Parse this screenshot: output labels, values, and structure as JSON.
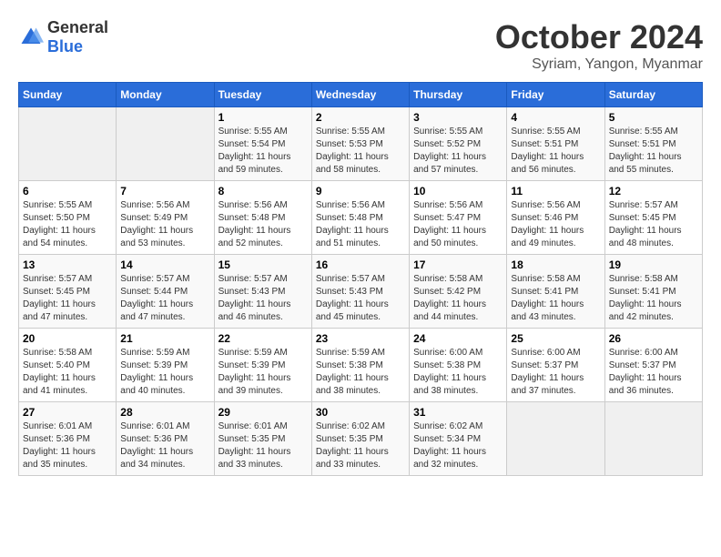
{
  "header": {
    "logo_general": "General",
    "logo_blue": "Blue",
    "title": "October 2024",
    "subtitle": "Syriam, Yangon, Myanmar"
  },
  "weekdays": [
    "Sunday",
    "Monday",
    "Tuesday",
    "Wednesday",
    "Thursday",
    "Friday",
    "Saturday"
  ],
  "weeks": [
    [
      {
        "day": "",
        "sunrise": "",
        "sunset": "",
        "daylight": ""
      },
      {
        "day": "",
        "sunrise": "",
        "sunset": "",
        "daylight": ""
      },
      {
        "day": "1",
        "sunrise": "Sunrise: 5:55 AM",
        "sunset": "Sunset: 5:54 PM",
        "daylight": "Daylight: 11 hours and 59 minutes."
      },
      {
        "day": "2",
        "sunrise": "Sunrise: 5:55 AM",
        "sunset": "Sunset: 5:53 PM",
        "daylight": "Daylight: 11 hours and 58 minutes."
      },
      {
        "day": "3",
        "sunrise": "Sunrise: 5:55 AM",
        "sunset": "Sunset: 5:52 PM",
        "daylight": "Daylight: 11 hours and 57 minutes."
      },
      {
        "day": "4",
        "sunrise": "Sunrise: 5:55 AM",
        "sunset": "Sunset: 5:51 PM",
        "daylight": "Daylight: 11 hours and 56 minutes."
      },
      {
        "day": "5",
        "sunrise": "Sunrise: 5:55 AM",
        "sunset": "Sunset: 5:51 PM",
        "daylight": "Daylight: 11 hours and 55 minutes."
      }
    ],
    [
      {
        "day": "6",
        "sunrise": "Sunrise: 5:55 AM",
        "sunset": "Sunset: 5:50 PM",
        "daylight": "Daylight: 11 hours and 54 minutes."
      },
      {
        "day": "7",
        "sunrise": "Sunrise: 5:56 AM",
        "sunset": "Sunset: 5:49 PM",
        "daylight": "Daylight: 11 hours and 53 minutes."
      },
      {
        "day": "8",
        "sunrise": "Sunrise: 5:56 AM",
        "sunset": "Sunset: 5:48 PM",
        "daylight": "Daylight: 11 hours and 52 minutes."
      },
      {
        "day": "9",
        "sunrise": "Sunrise: 5:56 AM",
        "sunset": "Sunset: 5:48 PM",
        "daylight": "Daylight: 11 hours and 51 minutes."
      },
      {
        "day": "10",
        "sunrise": "Sunrise: 5:56 AM",
        "sunset": "Sunset: 5:47 PM",
        "daylight": "Daylight: 11 hours and 50 minutes."
      },
      {
        "day": "11",
        "sunrise": "Sunrise: 5:56 AM",
        "sunset": "Sunset: 5:46 PM",
        "daylight": "Daylight: 11 hours and 49 minutes."
      },
      {
        "day": "12",
        "sunrise": "Sunrise: 5:57 AM",
        "sunset": "Sunset: 5:45 PM",
        "daylight": "Daylight: 11 hours and 48 minutes."
      }
    ],
    [
      {
        "day": "13",
        "sunrise": "Sunrise: 5:57 AM",
        "sunset": "Sunset: 5:45 PM",
        "daylight": "Daylight: 11 hours and 47 minutes."
      },
      {
        "day": "14",
        "sunrise": "Sunrise: 5:57 AM",
        "sunset": "Sunset: 5:44 PM",
        "daylight": "Daylight: 11 hours and 47 minutes."
      },
      {
        "day": "15",
        "sunrise": "Sunrise: 5:57 AM",
        "sunset": "Sunset: 5:43 PM",
        "daylight": "Daylight: 11 hours and 46 minutes."
      },
      {
        "day": "16",
        "sunrise": "Sunrise: 5:57 AM",
        "sunset": "Sunset: 5:43 PM",
        "daylight": "Daylight: 11 hours and 45 minutes."
      },
      {
        "day": "17",
        "sunrise": "Sunrise: 5:58 AM",
        "sunset": "Sunset: 5:42 PM",
        "daylight": "Daylight: 11 hours and 44 minutes."
      },
      {
        "day": "18",
        "sunrise": "Sunrise: 5:58 AM",
        "sunset": "Sunset: 5:41 PM",
        "daylight": "Daylight: 11 hours and 43 minutes."
      },
      {
        "day": "19",
        "sunrise": "Sunrise: 5:58 AM",
        "sunset": "Sunset: 5:41 PM",
        "daylight": "Daylight: 11 hours and 42 minutes."
      }
    ],
    [
      {
        "day": "20",
        "sunrise": "Sunrise: 5:58 AM",
        "sunset": "Sunset: 5:40 PM",
        "daylight": "Daylight: 11 hours and 41 minutes."
      },
      {
        "day": "21",
        "sunrise": "Sunrise: 5:59 AM",
        "sunset": "Sunset: 5:39 PM",
        "daylight": "Daylight: 11 hours and 40 minutes."
      },
      {
        "day": "22",
        "sunrise": "Sunrise: 5:59 AM",
        "sunset": "Sunset: 5:39 PM",
        "daylight": "Daylight: 11 hours and 39 minutes."
      },
      {
        "day": "23",
        "sunrise": "Sunrise: 5:59 AM",
        "sunset": "Sunset: 5:38 PM",
        "daylight": "Daylight: 11 hours and 38 minutes."
      },
      {
        "day": "24",
        "sunrise": "Sunrise: 6:00 AM",
        "sunset": "Sunset: 5:38 PM",
        "daylight": "Daylight: 11 hours and 38 minutes."
      },
      {
        "day": "25",
        "sunrise": "Sunrise: 6:00 AM",
        "sunset": "Sunset: 5:37 PM",
        "daylight": "Daylight: 11 hours and 37 minutes."
      },
      {
        "day": "26",
        "sunrise": "Sunrise: 6:00 AM",
        "sunset": "Sunset: 5:37 PM",
        "daylight": "Daylight: 11 hours and 36 minutes."
      }
    ],
    [
      {
        "day": "27",
        "sunrise": "Sunrise: 6:01 AM",
        "sunset": "Sunset: 5:36 PM",
        "daylight": "Daylight: 11 hours and 35 minutes."
      },
      {
        "day": "28",
        "sunrise": "Sunrise: 6:01 AM",
        "sunset": "Sunset: 5:36 PM",
        "daylight": "Daylight: 11 hours and 34 minutes."
      },
      {
        "day": "29",
        "sunrise": "Sunrise: 6:01 AM",
        "sunset": "Sunset: 5:35 PM",
        "daylight": "Daylight: 11 hours and 33 minutes."
      },
      {
        "day": "30",
        "sunrise": "Sunrise: 6:02 AM",
        "sunset": "Sunset: 5:35 PM",
        "daylight": "Daylight: 11 hours and 33 minutes."
      },
      {
        "day": "31",
        "sunrise": "Sunrise: 6:02 AM",
        "sunset": "Sunset: 5:34 PM",
        "daylight": "Daylight: 11 hours and 32 minutes."
      },
      {
        "day": "",
        "sunrise": "",
        "sunset": "",
        "daylight": ""
      },
      {
        "day": "",
        "sunrise": "",
        "sunset": "",
        "daylight": ""
      }
    ]
  ]
}
